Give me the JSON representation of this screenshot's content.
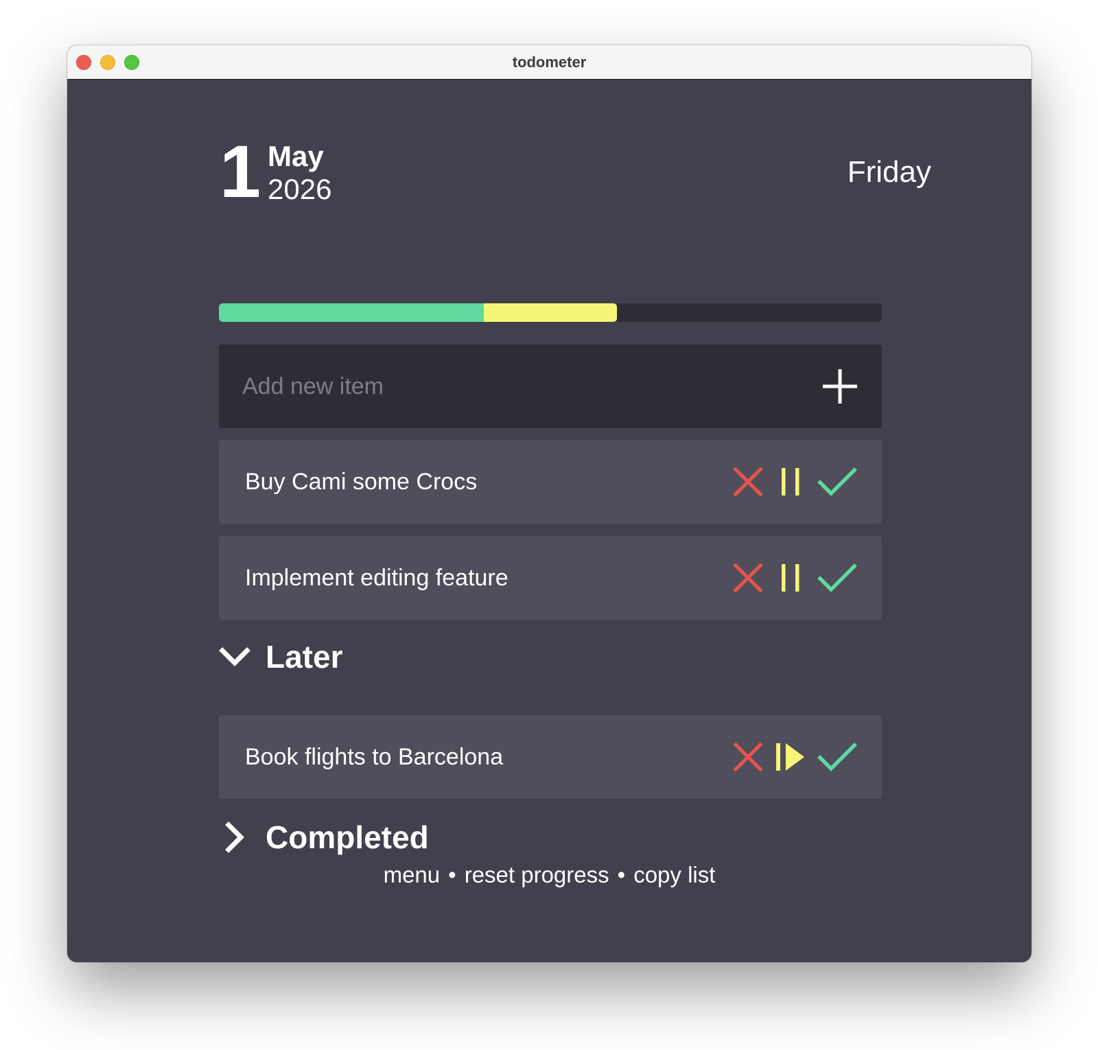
{
  "window": {
    "title": "todometer"
  },
  "date": {
    "day": "1",
    "month": "May",
    "year": "2026",
    "weekday": "Friday"
  },
  "progress": {
    "done_fraction": 0.4,
    "paused_fraction": 0.2,
    "colors": {
      "done": "#5fd9a0",
      "paused": "#f5f57a",
      "track": "#2e2d36"
    }
  },
  "add_item": {
    "placeholder": "Add new item",
    "icon": "plus-icon"
  },
  "items": [
    {
      "label": "Buy Cami some Crocs",
      "state": "active"
    },
    {
      "label": "Implement editing feature",
      "state": "active"
    }
  ],
  "later": {
    "label": "Later",
    "expanded": true,
    "items": [
      {
        "label": "Book flights to Barcelona",
        "state": "paused"
      }
    ]
  },
  "completed": {
    "label": "Completed",
    "expanded": false
  },
  "footer": {
    "menu": "menu",
    "reset": "reset progress",
    "copy": "copy list",
    "separator": "•"
  },
  "colors": {
    "background": "#41404c",
    "card": "#4f4e5a",
    "delete": "#e8554e",
    "pause": "#f5f57a",
    "done": "#5fd9a0"
  }
}
